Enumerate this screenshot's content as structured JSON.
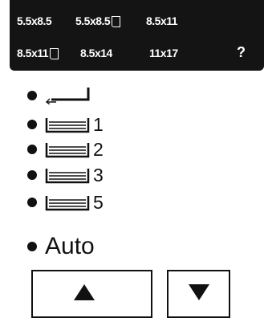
{
  "paper_sizes": {
    "s1": "5.5x8.5",
    "s2": "5.5x8.5",
    "s3": "8.5x11",
    "s4": "8.5x11",
    "s5": "8.5x14",
    "s6": "11x17",
    "help": "?"
  },
  "trays": {
    "t1": "1",
    "t2": "2",
    "t3": "3",
    "t5": "5"
  },
  "auto_label": "Auto",
  "icons": {
    "bypass": "return-arrow-icon",
    "tray": "paper-tray-icon",
    "portrait": "portrait-sheet-icon",
    "scroll_up": "up-arrow-icon",
    "scroll_down": "down-arrow-icon"
  }
}
